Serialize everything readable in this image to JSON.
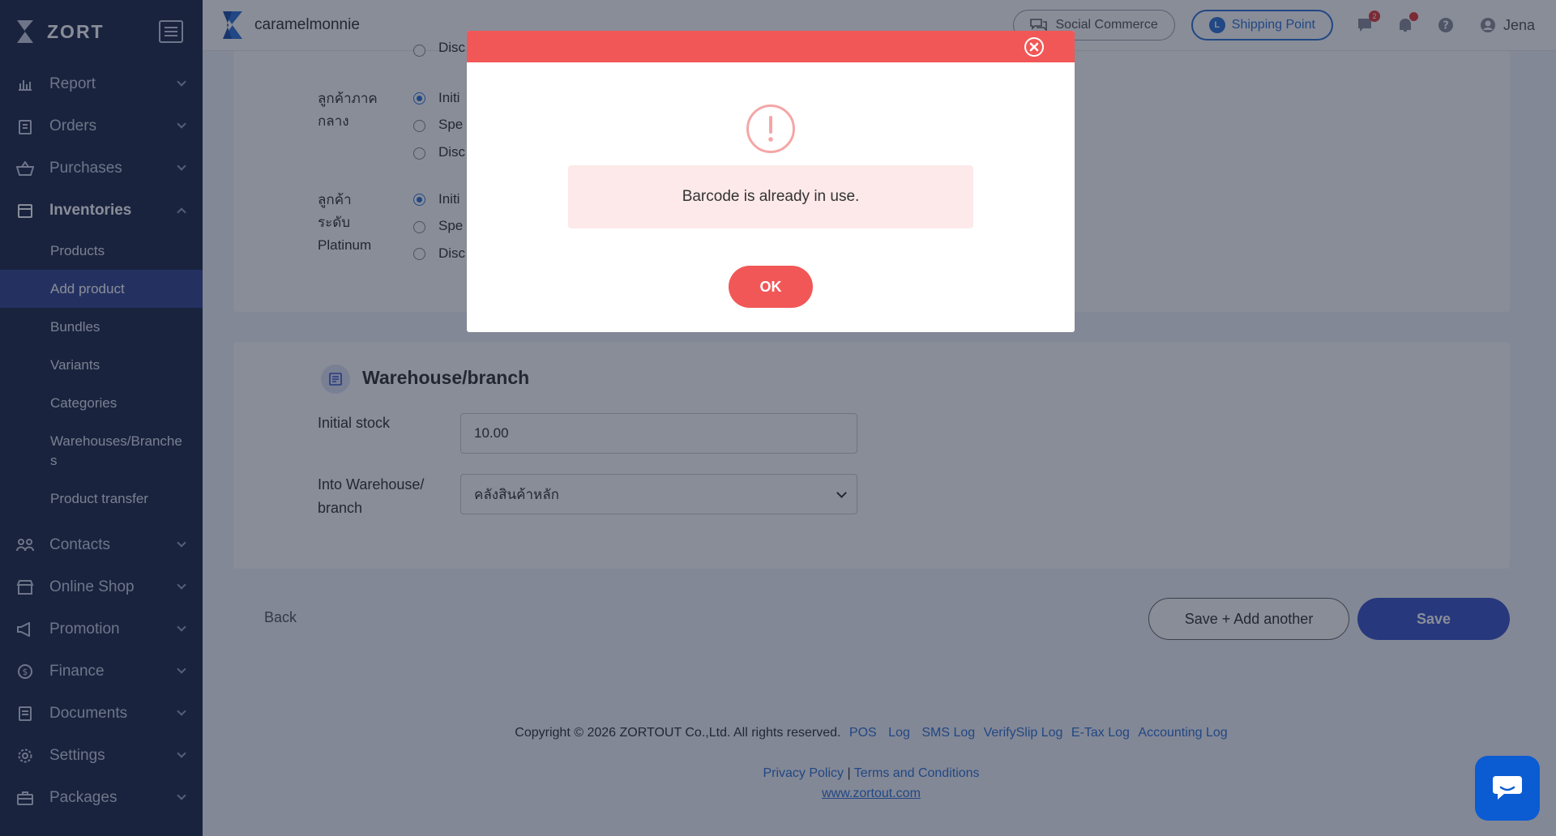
{
  "sidebar": {
    "brand": "ZORT",
    "items": [
      {
        "label": "Report",
        "icon": "bar-chart-icon"
      },
      {
        "label": "Orders",
        "icon": "clipboard-icon"
      },
      {
        "label": "Purchases",
        "icon": "basket-icon"
      },
      {
        "label": "Inventories",
        "icon": "box-icon"
      },
      {
        "label": "Contacts",
        "icon": "people-icon"
      },
      {
        "label": "Online Shop",
        "icon": "store-icon"
      },
      {
        "label": "Promotion",
        "icon": "megaphone-icon"
      },
      {
        "label": "Finance",
        "icon": "dollar-icon"
      },
      {
        "label": "Documents",
        "icon": "document-icon"
      },
      {
        "label": "Settings",
        "icon": "gear-icon"
      },
      {
        "label": "Packages",
        "icon": "briefcase-icon"
      }
    ],
    "inventory_sub": [
      "Products",
      "Add product",
      "Bundles",
      "Variants",
      "Categories",
      "Warehouses/Branches",
      "Product transfer"
    ]
  },
  "header": {
    "shop_name": "caramelmonnie",
    "social_commerce": "Social Commerce",
    "shipping_point": "Shipping Point",
    "chat_badge": "2",
    "user": "Jena"
  },
  "pricing": {
    "tiers": [
      {
        "label": "ลูกค้าภาคกลาง"
      },
      {
        "label": "ลูกค้าระดับ Platinum"
      }
    ],
    "options_visible": [
      "Initi",
      "Spe",
      "Disc"
    ],
    "top_cut_option": "Disc"
  },
  "warehouse": {
    "title": "Warehouse/branch",
    "initial_stock_label": "Initial stock",
    "initial_stock_value": "10.00",
    "into_label": "Into Warehouse/branch",
    "into_value": "คลังสินค้าหลัก"
  },
  "actions": {
    "back": "Back",
    "save_add": "Save + Add another",
    "save": "Save"
  },
  "footer": {
    "copyright": "Copyright © 2026 ZORTOUT Co.,Ltd. All rights reserved.",
    "links": [
      "POS",
      "Log",
      "SMS Log",
      "VerifySlip Log",
      "E-Tax Log",
      "Accounting Log"
    ],
    "privacy": "Privacy Policy",
    "separator": "|",
    "terms": "Terms and Conditions",
    "site": "www.zortout.com"
  },
  "modal": {
    "message": "Barcode is already in use.",
    "ok": "OK",
    "colors": {
      "header": "#f25757",
      "message_bg": "#fde9ea"
    }
  }
}
